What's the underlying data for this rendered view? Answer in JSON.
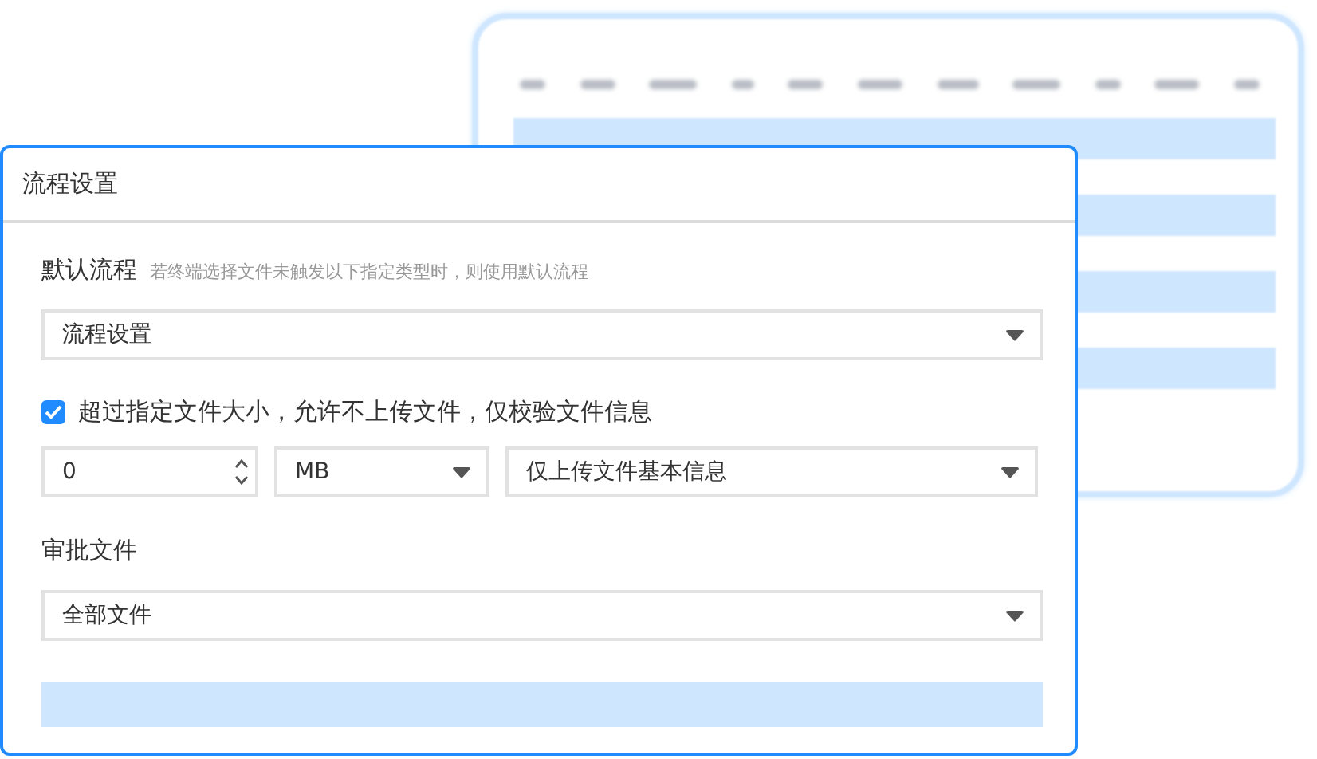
{
  "dialog": {
    "title": "流程设置"
  },
  "default_flow": {
    "label": "默认流程",
    "hint": "若终端选择文件未触发以下指定类型时，则使用默认流程",
    "select": {
      "value": "流程设置"
    }
  },
  "size_limit": {
    "checked": true,
    "label": "超过指定文件大小，允许不上传文件，仅校验文件信息",
    "number": {
      "value": "0"
    },
    "unit": {
      "value": "MB"
    },
    "mode": {
      "value": "仅上传文件基本信息"
    }
  },
  "approval_files": {
    "label": "审批文件",
    "select": {
      "value": "全部文件"
    }
  }
}
